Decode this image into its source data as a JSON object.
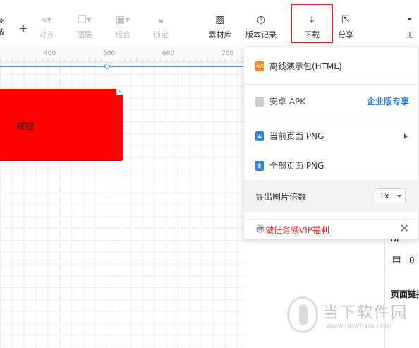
{
  "toolbar": {
    "zoom_text": "%",
    "zoom_label": "放",
    "plus": "+",
    "align": "对齐",
    "layers": "图层",
    "group": "组合",
    "lock": "锁定",
    "assets": "素材库",
    "history": "版本记录",
    "download": "下载",
    "share": "分享",
    "cut_label": "工"
  },
  "ruler": {
    "marks": [
      "400",
      "500",
      "600",
      "700"
    ]
  },
  "canvas": {
    "widget_label": "按钮",
    "widget_color": "#fe0000"
  },
  "menu": {
    "offline_package": "离线演示包(HTML)",
    "android_apk": "安卓 APK",
    "enterprise_badge": "企业版专享",
    "current_page_png": "当前页面 PNG",
    "all_pages_png": "全部页面 PNG",
    "export_scale_label": "导出图片倍数",
    "export_scale_value": "1x",
    "vip_link": "做任务领VIP福利",
    "close_symbol": "✕"
  },
  "panel": {
    "count_value": "0",
    "page_link_label": "页面链接",
    "partial_label": "所"
  },
  "watermark": {
    "title": "当下软件园",
    "url": "www.downxia.com"
  },
  "colors": {
    "accent_blue": "#2e7be6",
    "highlight_red": "#e5262b"
  }
}
